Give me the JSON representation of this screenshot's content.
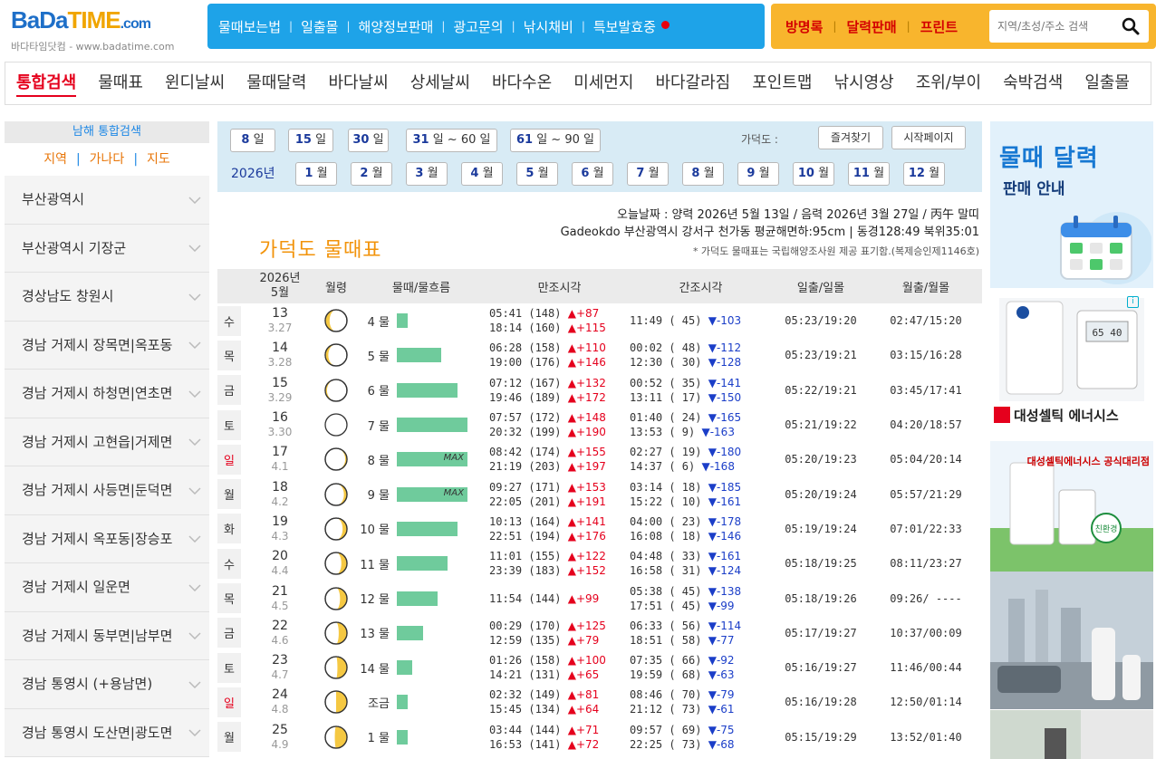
{
  "logo": {
    "brand_part1": "BaDa",
    "brand_part2": "TIME",
    "brand_part3": ".com",
    "subtitle": "바다타임닷컴 - www.badatime.com"
  },
  "top_menu": [
    "물때보는법",
    "일출몰",
    "해양정보판매",
    "광고문의",
    "낚시채비",
    "특보발효중"
  ],
  "orange_menu": [
    "방명록",
    "달력판매",
    "프린트"
  ],
  "search": {
    "placeholder": "지역/초성/주소 검색"
  },
  "tabs": [
    "통합검색",
    "물때표",
    "윈디날씨",
    "물때달력",
    "바다날씨",
    "상세날씨",
    "바다수온",
    "미세먼지",
    "바다갈라짐",
    "포인트맵",
    "낚시영상",
    "조위/부이",
    "숙박검색",
    "일출몰"
  ],
  "sidebar": {
    "header": "남해 통합검색",
    "links": [
      "지역",
      "가나다",
      "지도"
    ],
    "items": [
      "부산광역시",
      "부산광역시 기장군",
      "경상남도 창원시",
      "경남 거제시 장목면|옥포동",
      "경남 거제시 하청면|연초면",
      "경남 거제시 고현읍|거제면",
      "경남 거제시 사등면|둔덕면",
      "경남 거제시 옥포동|장승포",
      "경남 거제시 일운면",
      "경남 거제시 동부면|남부면",
      "경남 통영시 (+용남면)",
      "경남 통영시 도산면|광도면"
    ]
  },
  "date_panel": {
    "range_buttons": [
      [
        "8",
        "일"
      ],
      [
        "15",
        "일"
      ],
      [
        "30",
        "일"
      ],
      [
        "31",
        "일 ~ 60",
        "일"
      ],
      [
        "61",
        "일 ~ 90",
        "일"
      ]
    ],
    "location_label": "가덕도 :",
    "favorite_button": "즐겨찾기",
    "homepage_button": "시작페이지",
    "year_label": "2026년",
    "months": [
      "1",
      "2",
      "3",
      "4",
      "5",
      "6",
      "7",
      "8",
      "9",
      "10",
      "11",
      "12"
    ],
    "month_suffix": "월"
  },
  "info": {
    "line1": "오늘날짜 : 양력 2026년 5월 13일 / 음력 2026년 3월 27일 / 丙午 말띠",
    "line2": "Gadeokdo 부산광역시 강서구 천가동 평균해면하:95cm | 동경128:49 북위35:01",
    "line3": "* 가덕도 물때표는 국립해양조사원 제공 표기함.(복제승인제1146호)"
  },
  "page_title": "가덕도 물때표",
  "table": {
    "header": {
      "year": "2026년",
      "month": "5월",
      "moon": "월령",
      "tide": "물때/물흐름",
      "high": "만조시각",
      "low": "간조시각",
      "sun": "일출/일몰",
      "moonrs": "월출/월몰"
    },
    "max_label": "MAX",
    "rows": [
      {
        "dow": "수",
        "red": false,
        "date": "13",
        "lunar": "3.27",
        "moon_phase": 0.9,
        "tide": "4 물",
        "flow": 0.15,
        "max": false,
        "high": [
          [
            "05:41 (148)",
            "▲+87"
          ],
          [
            "18:14 (160)",
            "▲+115"
          ]
        ],
        "low": [
          [
            "11:49 ( 45)",
            "▼-103"
          ]
        ],
        "sun": "05:23/19:20",
        "moonrs": "02:47/15:20"
      },
      {
        "dow": "목",
        "red": false,
        "date": "14",
        "lunar": "3.28",
        "moon_phase": 0.93,
        "tide": "5 물",
        "flow": 0.63,
        "max": false,
        "high": [
          [
            "06:28 (158)",
            "▲+110"
          ],
          [
            "19:00 (176)",
            "▲+146"
          ]
        ],
        "low": [
          [
            "00:02 ( 48)",
            "▼-112"
          ],
          [
            "12:30 ( 30)",
            "▼-128"
          ]
        ],
        "sun": "05:23/19:21",
        "moonrs": "03:15/16:28"
      },
      {
        "dow": "금",
        "red": false,
        "date": "15",
        "lunar": "3.29",
        "moon_phase": 0.96,
        "tide": "6 물",
        "flow": 0.86,
        "max": false,
        "high": [
          [
            "07:12 (167)",
            "▲+132"
          ],
          [
            "19:46 (189)",
            "▲+172"
          ]
        ],
        "low": [
          [
            "00:52 ( 35)",
            "▼-141"
          ],
          [
            "13:11 ( 17)",
            "▼-150"
          ]
        ],
        "sun": "05:22/19:21",
        "moonrs": "03:45/17:41"
      },
      {
        "dow": "토",
        "red": false,
        "date": "16",
        "lunar": "3.30",
        "moon_phase": 0.0,
        "tide": "7 물",
        "flow": 1.0,
        "max": false,
        "high": [
          [
            "07:57 (172)",
            "▲+148"
          ],
          [
            "20:32 (199)",
            "▲+190"
          ]
        ],
        "low": [
          [
            "01:40 ( 24)",
            "▼-165"
          ],
          [
            "13:53 (  9)",
            "▼-163"
          ]
        ],
        "sun": "05:21/19:22",
        "moonrs": "04:20/18:57"
      },
      {
        "dow": "일",
        "red": true,
        "date": "17",
        "lunar": "4.1",
        "moon_phase": 0.04,
        "tide": "8 물",
        "flow": 1.0,
        "max": true,
        "high": [
          [
            "08:42 (174)",
            "▲+155"
          ],
          [
            "21:19 (203)",
            "▲+197"
          ]
        ],
        "low": [
          [
            "02:27 ( 19)",
            "▼-180"
          ],
          [
            "14:37 (  6)",
            "▼-168"
          ]
        ],
        "sun": "05:20/19:23",
        "moonrs": "05:04/20:14"
      },
      {
        "dow": "월",
        "red": false,
        "date": "18",
        "lunar": "4.2",
        "moon_phase": 0.07,
        "tide": "9 물",
        "flow": 1.0,
        "max": true,
        "high": [
          [
            "09:27 (171)",
            "▲+153"
          ],
          [
            "22:05 (201)",
            "▲+191"
          ]
        ],
        "low": [
          [
            "03:14 ( 18)",
            "▼-185"
          ],
          [
            "15:22 ( 10)",
            "▼-161"
          ]
        ],
        "sun": "05:20/19:24",
        "moonrs": "05:57/21:29"
      },
      {
        "dow": "화",
        "red": false,
        "date": "19",
        "lunar": "4.3",
        "moon_phase": 0.1,
        "tide": "10 물",
        "flow": 0.86,
        "max": false,
        "high": [
          [
            "10:13 (164)",
            "▲+141"
          ],
          [
            "22:51 (194)",
            "▲+176"
          ]
        ],
        "low": [
          [
            "04:00 ( 23)",
            "▼-178"
          ],
          [
            "16:08 ( 18)",
            "▼-146"
          ]
        ],
        "sun": "05:19/19:24",
        "moonrs": "07:01/22:33"
      },
      {
        "dow": "수",
        "red": false,
        "date": "20",
        "lunar": "4.4",
        "moon_phase": 0.13,
        "tide": "11 물",
        "flow": 0.72,
        "max": false,
        "high": [
          [
            "11:01 (155)",
            "▲+122"
          ],
          [
            "23:39 (183)",
            "▲+152"
          ]
        ],
        "low": [
          [
            "04:48 ( 33)",
            "▼-161"
          ],
          [
            "16:58 ( 31)",
            "▼-124"
          ]
        ],
        "sun": "05:18/19:25",
        "moonrs": "08:11/23:27"
      },
      {
        "dow": "목",
        "red": false,
        "date": "21",
        "lunar": "4.5",
        "moon_phase": 0.16,
        "tide": "12 물",
        "flow": 0.58,
        "max": false,
        "high": [
          [
            "11:54 (144)",
            "▲+99"
          ]
        ],
        "low": [
          [
            "05:38 ( 45)",
            "▼-138"
          ],
          [
            "17:51 ( 45)",
            "▼-99"
          ]
        ],
        "sun": "05:18/19:26",
        "moonrs": "09:26/ ----"
      },
      {
        "dow": "금",
        "red": false,
        "date": "22",
        "lunar": "4.6",
        "moon_phase": 0.19,
        "tide": "13 물",
        "flow": 0.37,
        "max": false,
        "high": [
          [
            "00:29 (170)",
            "▲+125"
          ],
          [
            "12:59 (135)",
            "▲+79"
          ]
        ],
        "low": [
          [
            "06:33 ( 56)",
            "▼-114"
          ],
          [
            "18:51 ( 58)",
            "▼-77"
          ]
        ],
        "sun": "05:17/19:27",
        "moonrs": "10:37/00:09"
      },
      {
        "dow": "토",
        "red": false,
        "date": "23",
        "lunar": "4.7",
        "moon_phase": 0.22,
        "tide": "14 물",
        "flow": 0.22,
        "max": false,
        "high": [
          [
            "01:26 (158)",
            "▲+100"
          ],
          [
            "14:21 (131)",
            "▲+65"
          ]
        ],
        "low": [
          [
            "07:35 ( 66)",
            "▼-92"
          ],
          [
            "19:59 ( 68)",
            "▼-63"
          ]
        ],
        "sun": "05:16/19:27",
        "moonrs": "11:46/00:44"
      },
      {
        "dow": "일",
        "red": true,
        "date": "24",
        "lunar": "4.8",
        "moon_phase": 0.25,
        "tide": "조금",
        "flow": 0.15,
        "max": false,
        "high": [
          [
            "02:32 (149)",
            "▲+81"
          ],
          [
            "15:45 (134)",
            "▲+64"
          ]
        ],
        "low": [
          [
            "08:46 ( 70)",
            "▼-79"
          ],
          [
            "21:12 ( 73)",
            "▼-61"
          ]
        ],
        "sun": "05:16/19:28",
        "moonrs": "12:50/01:14"
      },
      {
        "dow": "월",
        "red": false,
        "date": "25",
        "lunar": "4.9",
        "moon_phase": 0.28,
        "tide": "1 물",
        "flow": 0.15,
        "max": false,
        "high": [
          [
            "03:44 (144)",
            "▲+71"
          ],
          [
            "16:53 (141)",
            "▲+72"
          ]
        ],
        "low": [
          [
            "09:57 ( 69)",
            "▼-75"
          ],
          [
            "22:25 ( 73)",
            "▼-68"
          ]
        ],
        "sun": "05:15/19:29",
        "moonrs": "13:52/01:40"
      }
    ]
  },
  "ads": {
    "ad1_title": "물때 달력",
    "ad1_subtitle": "판매 안내",
    "ad2_brand": "대성셀틱 에너시스",
    "ad3_brand": "대성셀틱에너시스 공식대리점",
    "ad3_badge": "친환경",
    "ad2_display": "65 40"
  },
  "colors": {
    "accent_blue": "#1ea3e8",
    "accent_orange": "#f8b52d",
    "title_orange": "#f2930a",
    "active_tab_red": "#e5001d",
    "tide_bar": "#6fcb9c",
    "moon_yellow": "#f5c842"
  }
}
